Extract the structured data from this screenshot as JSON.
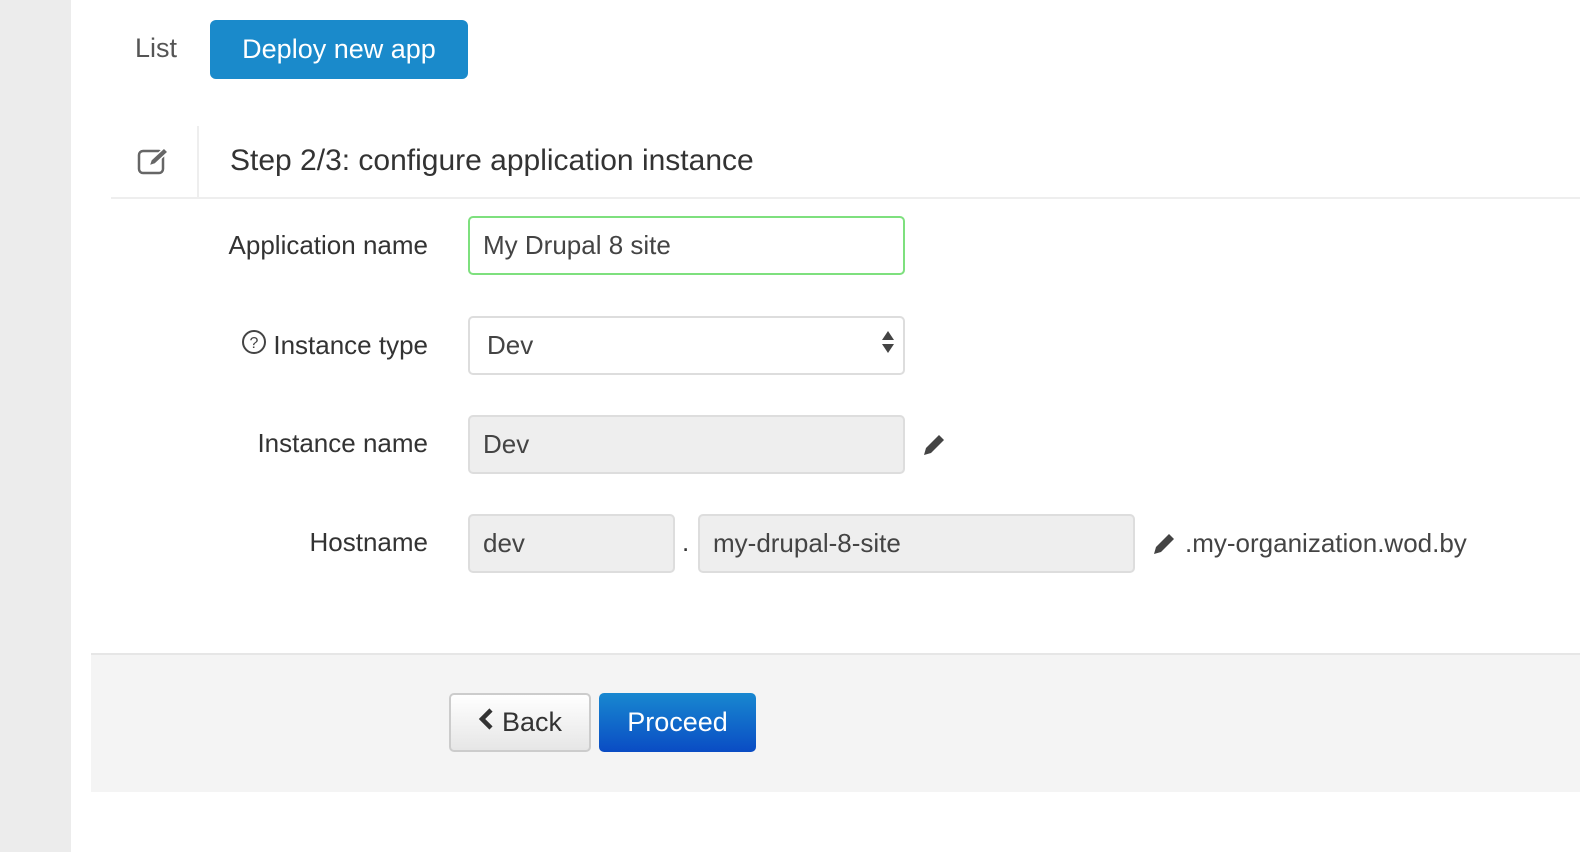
{
  "nav": {
    "list_label": "List",
    "deploy_label": "Deploy new app"
  },
  "step": {
    "title": "Step 2/3: configure application instance"
  },
  "form": {
    "app_name": {
      "label": "Application name",
      "value": "My Drupal 8 site"
    },
    "instance_type": {
      "label": "Instance type",
      "value": "Dev"
    },
    "instance_name": {
      "label": "Instance name",
      "value": "Dev"
    },
    "hostname": {
      "label": "Hostname",
      "prefix": "dev",
      "separator": ".",
      "name": "my-drupal-8-site",
      "suffix": ".my-organization.wod.by"
    }
  },
  "actions": {
    "back_label": "Back",
    "proceed_label": "Proceed"
  },
  "colors": {
    "primary": "#1a8acb",
    "proceed": "#0a4cc4",
    "valid_border": "#7ee07e"
  }
}
